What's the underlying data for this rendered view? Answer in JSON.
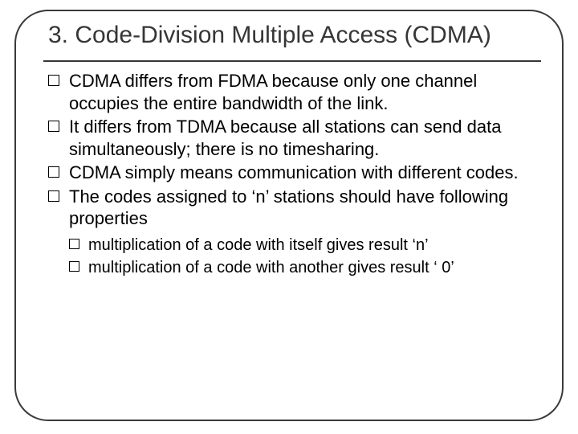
{
  "slide": {
    "title": "3. Code-Division Multiple Access (CDMA)",
    "bullets": [
      {
        "text": "CDMA differs from FDMA because only one channel occupies the entire bandwidth of the link."
      },
      {
        "text": "It differs from TDMA because all stations can send data simultaneously; there is no timesharing."
      },
      {
        "text": "CDMA simply means communication with different codes."
      },
      {
        "text": "The codes assigned to ‘n’ stations should have following properties"
      }
    ],
    "sub_bullets": [
      {
        "text": "multiplication of a code with itself  gives result ‘n’"
      },
      {
        "text": "multiplication of a code with another  gives result ‘ 0’"
      }
    ]
  }
}
